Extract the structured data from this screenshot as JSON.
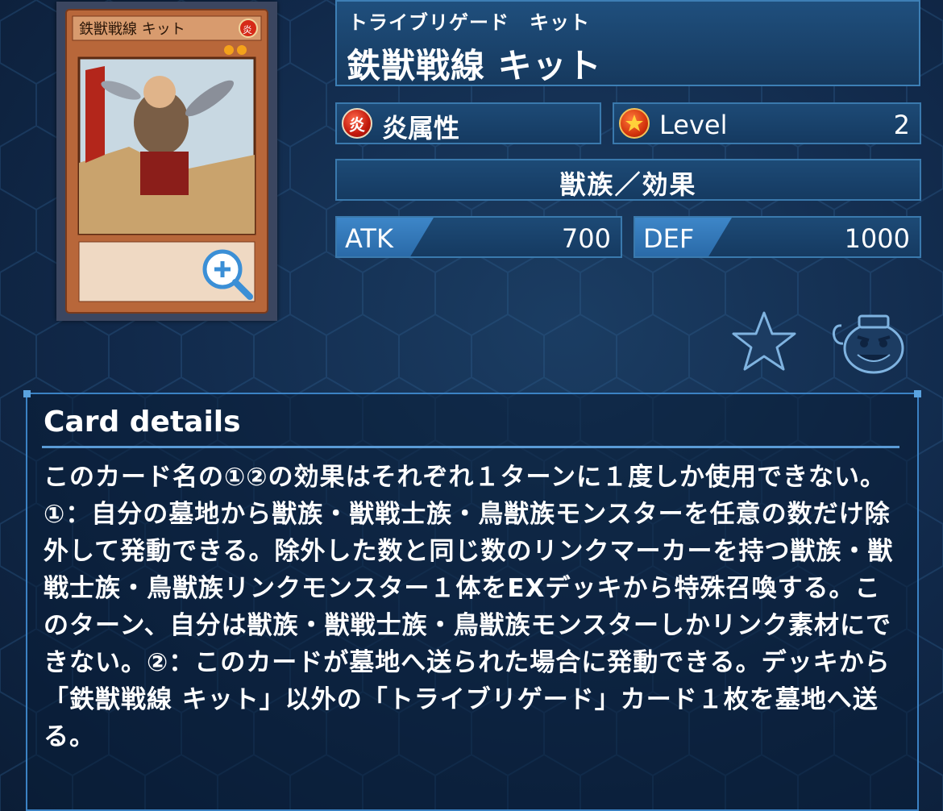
{
  "card": {
    "ruby": "トライブリゲード　キット",
    "name": "鉄獣戦線 キット",
    "attribute_glyph": "炎",
    "attribute": "炎属性",
    "level_label": "Level",
    "level_value": "2",
    "type_line": "獣族／効果",
    "atk_label": "ATK",
    "atk_value": "700",
    "def_label": "DEF",
    "def_value": "1000",
    "thumbnail_title": "鉄獣戦線 キット",
    "thumbnail_attr": "炎"
  },
  "actions": {
    "zoom_icon": "zoom-in-icon",
    "favorite_icon": "star-icon",
    "pot_icon": "pot-of-greed-icon"
  },
  "details": {
    "title": "Card details",
    "text": "このカード名の①②の効果はそれぞれ１ターンに１度しか使用できない。①：自分の墓地から獣族・獣戦士族・鳥獣族モンスターを任意の数だけ除外して発動できる。除外した数と同じ数のリンクマーカーを持つ獣族・獣戦士族・鳥獣族リンクモンスター１体をEXデッキから特殊召喚する。このターン、自分は獣族・獣戦士族・鳥獣族モンスターしかリンク素材にできない。②：このカードが墓地へ送られた場合に発動できる。デッキから「鉄獣戦線 キット」以外の「トライブリゲード」カード１枚を墓地へ送る。"
  },
  "colors": {
    "accent": "#3b82c4",
    "fire": "#c2180c",
    "panel": "#1d4a76"
  }
}
